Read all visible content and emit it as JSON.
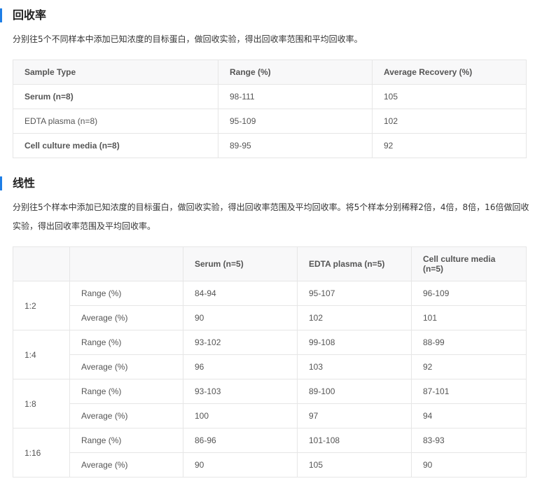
{
  "recovery": {
    "title": "回收率",
    "description": "分别往5个不同样本中添加已知浓度的目标蛋白，做回收实验，得出回收率范围和平均回收率。",
    "headers": [
      "Sample Type",
      "Range (%)",
      "Average Recovery (%)"
    ],
    "rows": [
      {
        "sample": "Serum (n=8)",
        "range": "98-111",
        "average": "105"
      },
      {
        "sample": "EDTA plasma (n=8)",
        "range": "95-109",
        "average": "102"
      },
      {
        "sample": "Cell culture media (n=8)",
        "range": "89-95",
        "average": "92"
      }
    ]
  },
  "linearity": {
    "title": "线性",
    "description": "分别往5个样本中添加已知浓度的目标蛋白，做回收实验，得出回收率范围及平均回收率。将5个样本分别稀释2倍，4倍，8倍，16倍做回收实验，得出回收率范围及平均回收率。",
    "headers": [
      "",
      "",
      "Serum (n=5)",
      "EDTA plasma (n=5)",
      "Cell culture media (n=5)"
    ],
    "range_label": "Range (%)",
    "average_label": "Average (%)",
    "groups": [
      {
        "dilution": "1:2",
        "range": [
          "84-94",
          "95-107",
          "96-109"
        ],
        "average": [
          "90",
          "102",
          "101"
        ]
      },
      {
        "dilution": "1:4",
        "range": [
          "93-102",
          "99-108",
          "88-99"
        ],
        "average": [
          "96",
          "103",
          "92"
        ]
      },
      {
        "dilution": "1:8",
        "range": [
          "93-103",
          "89-100",
          "87-101"
        ],
        "average": [
          "100",
          "97",
          "94"
        ]
      },
      {
        "dilution": "1:16",
        "range": [
          "86-96",
          "101-108",
          "83-93"
        ],
        "average": [
          "90",
          "105",
          "90"
        ]
      }
    ]
  }
}
